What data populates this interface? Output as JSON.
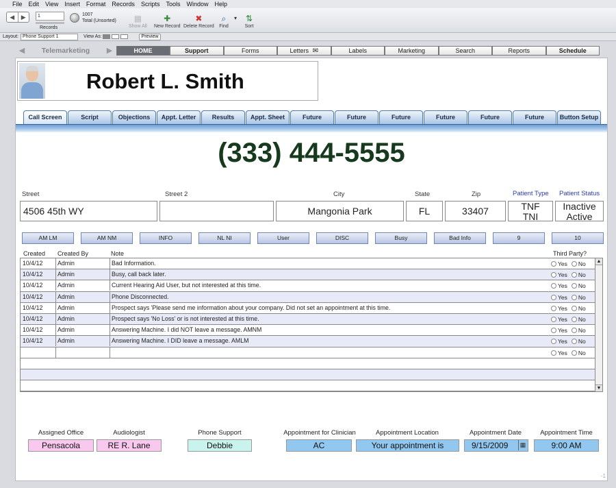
{
  "menu": [
    "File",
    "Edit",
    "View",
    "Insert",
    "Format",
    "Records",
    "Scripts",
    "Tools",
    "Window",
    "Help"
  ],
  "toolbar": {
    "record_current": "1",
    "records_label": "Records",
    "total_count": "1007",
    "total_status": "Total (Unsorted)",
    "show_all": "Show All",
    "new_record": "New Record",
    "delete_record": "Delete Record",
    "find": "Find",
    "sort": "Sort"
  },
  "layoutbar": {
    "layout_label": "Layout:",
    "layout_value": "Phone Support 1",
    "view_as_label": "View As:",
    "preview": "Preview"
  },
  "topnav": {
    "brand": "Telemarketing",
    "items": [
      "HOME",
      "Support",
      "Forms",
      "Letters",
      "Labels",
      "Marketing",
      "Search",
      "Reports",
      "Schedule"
    ]
  },
  "contact": {
    "name": "Robert L. Smith",
    "phone": "(333) 444-5555"
  },
  "tabs": [
    "Call Screen",
    "Script",
    "Objections",
    "Appt. Letter",
    "Results",
    "Appt. Sheet",
    "Future",
    "Future",
    "Future",
    "Future",
    "Future",
    "Future",
    "Button Setup"
  ],
  "address": {
    "street_label": "Street",
    "street": "4506 45th WY",
    "street2_label": "Street 2",
    "street2": "",
    "city_label": "City",
    "city": "Mangonia Park",
    "state_label": "State",
    "state": "FL",
    "zip_label": "Zip",
    "zip": "33407",
    "patient_type_label": "Patient Type",
    "patient_type": [
      "TNF",
      "TNI"
    ],
    "patient_status_label": "Patient Status",
    "patient_status": [
      "Inactive",
      "Active"
    ]
  },
  "quick_buttons": [
    "AM LM",
    "AM NM",
    "INFO",
    "NL NI",
    "User",
    "DISC",
    "Busy",
    "Bad Info",
    "9",
    "10"
  ],
  "notes": {
    "headers": {
      "created": "Created",
      "created_by": "Created By",
      "note": "Note",
      "third_party": "Third Party?"
    },
    "yes_label": "Yes",
    "no_label": "No",
    "rows": [
      {
        "created": "10/4/12",
        "by": "Admin",
        "note": "Bad Information."
      },
      {
        "created": "10/4/12",
        "by": "Admin",
        "note": "Busy, call back later."
      },
      {
        "created": "10/4/12",
        "by": "Admin",
        "note": "Current Hearing Aid User, but not interested at this time."
      },
      {
        "created": "10/4/12",
        "by": "Admin",
        "note": "Phone Disconnected."
      },
      {
        "created": "10/4/12",
        "by": "Admin",
        "note": "Prospect says 'Please send me information about your company. Did not set an appointment at this time."
      },
      {
        "created": "10/4/12",
        "by": "Admin",
        "note": "Prospect says 'No Loss' or is not interested at this time."
      },
      {
        "created": "10/4/12",
        "by": "Admin",
        "note": "Answering Machine. I did NOT leave a message. AMNM"
      },
      {
        "created": "10/4/12",
        "by": "Admin",
        "note": "Answering Machine. I DID leave a message. AMLM"
      },
      {
        "created": "",
        "by": "",
        "note": ""
      }
    ]
  },
  "bottom": {
    "assigned_office_label": "Assigned Office",
    "assigned_office": "Pensacola",
    "audiologist_label": "Audiologist",
    "audiologist": "RE R. Lane",
    "phone_support_label": "Phone Support",
    "phone_support": "Debbie",
    "clinician_label": "Appointment for Clinician",
    "clinician": "AC",
    "location_label": "Appointment Location",
    "location": "Your appointment is",
    "date_label": "Appointment Date",
    "date": "9/15/2009",
    "time_label": "Appointment Time",
    "time": "9:00 AM"
  },
  "page_number": "-1",
  "colors": {
    "pink_field": "#f9c8ee",
    "mint_field": "#c9f3ed",
    "blue_field": "#92c8f0",
    "phone_text": "#173a1e",
    "home_tab": "#6a6d73"
  }
}
